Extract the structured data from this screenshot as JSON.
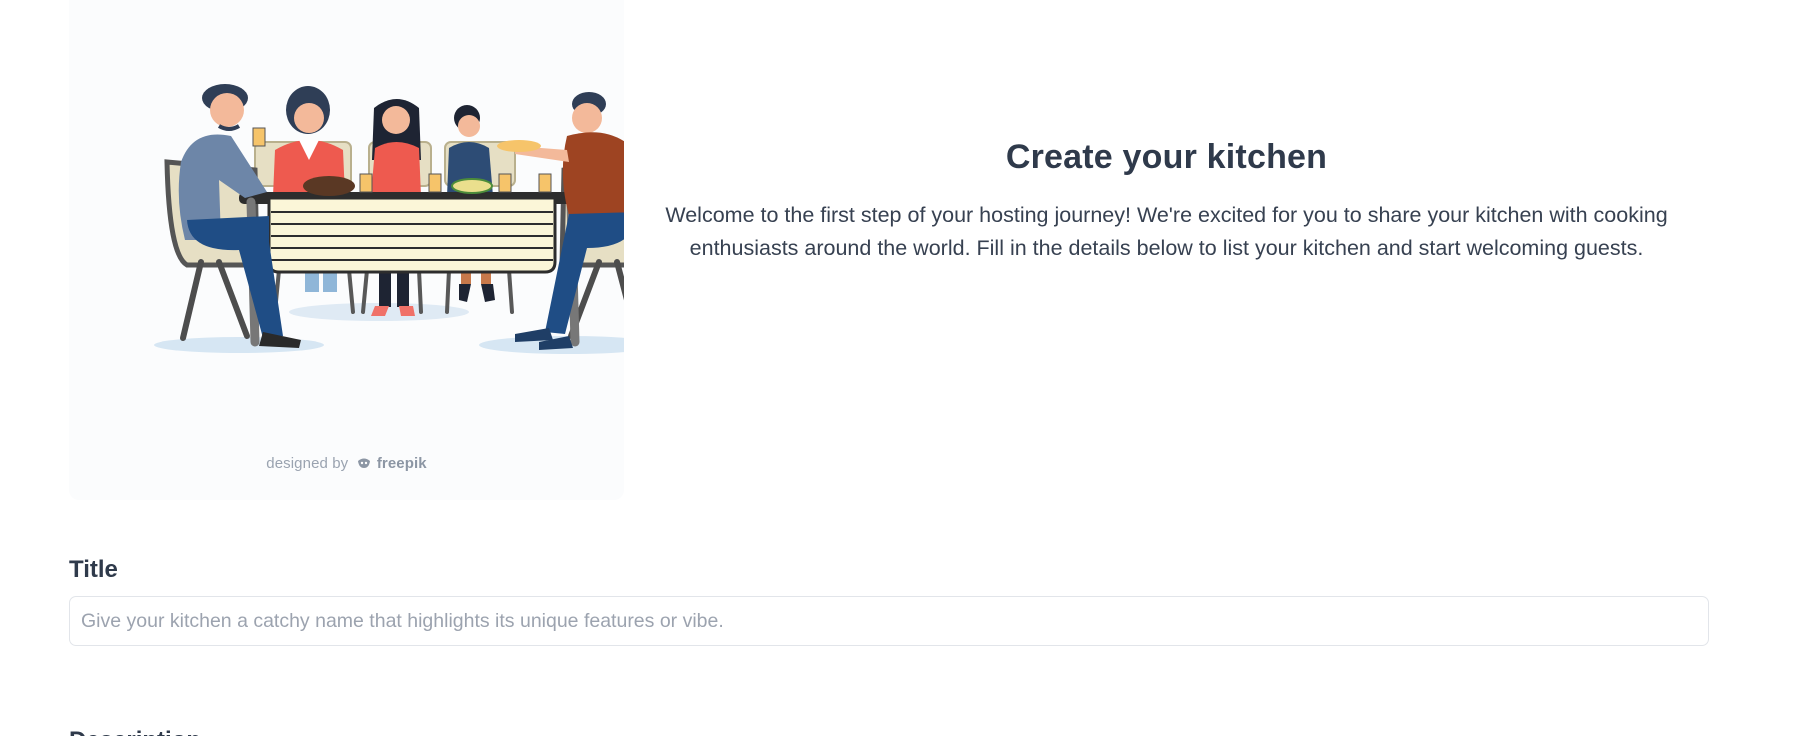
{
  "hero": {
    "illustration_alt": "",
    "credit_prefix": "designed by",
    "credit_brand": "freepik",
    "title": "Create your kitchen",
    "description": "Welcome to the first step of your hosting journey! We're excited for you to share your kitchen with cooking enthusiasts around the world. Fill in the details below to list your kitchen and start welcoming guests."
  },
  "form": {
    "title_label": "Title",
    "title_value": "",
    "title_placeholder": "Give your kitchen a catchy name that highlights its unique features or vibe.",
    "description_label": "Description"
  },
  "colors": {
    "heading": "#2f3a4b",
    "body_text": "#374151",
    "placeholder": "#9ca3af",
    "input_border": "#e2e5ea",
    "illustration_bg": "#fbfcfd"
  },
  "icons": {
    "brand_logo": "freepik-logo-icon"
  }
}
